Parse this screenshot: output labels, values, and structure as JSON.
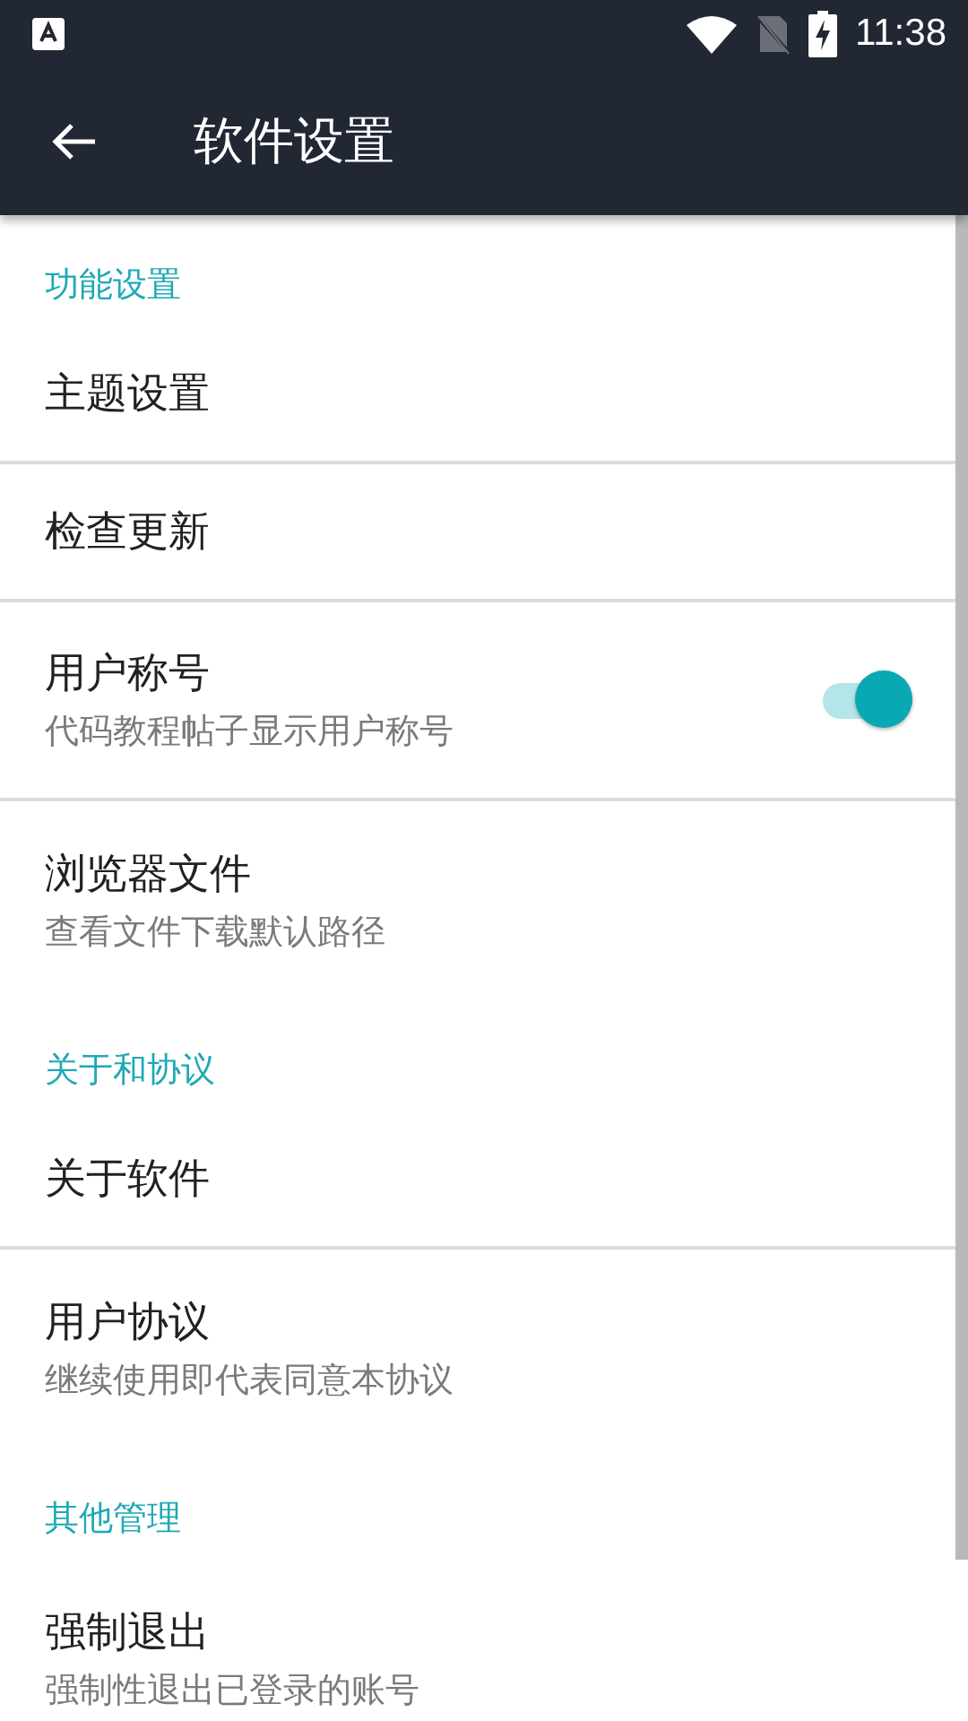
{
  "status_bar": {
    "time": "11:38"
  },
  "toolbar": {
    "title": "软件设置"
  },
  "sections": [
    {
      "title": "功能设置",
      "items": [
        {
          "kind": "plain",
          "title": "主题设置"
        },
        {
          "kind": "plain",
          "title": "检查更新"
        },
        {
          "kind": "switch",
          "title": "用户称号",
          "subtitle": "代码教程帖子显示用户称号",
          "on": true
        },
        {
          "kind": "plain",
          "title": "浏览器文件",
          "subtitle": "查看文件下载默认路径"
        }
      ]
    },
    {
      "title": "关于和协议",
      "items": [
        {
          "kind": "plain",
          "title": "关于软件"
        },
        {
          "kind": "plain",
          "title": "用户协议",
          "subtitle": "继续使用即代表同意本协议"
        }
      ]
    },
    {
      "title": "其他管理",
      "items": [
        {
          "kind": "plain",
          "title": "强制退出",
          "subtitle": "强制性退出已登录的账号"
        }
      ]
    }
  ]
}
